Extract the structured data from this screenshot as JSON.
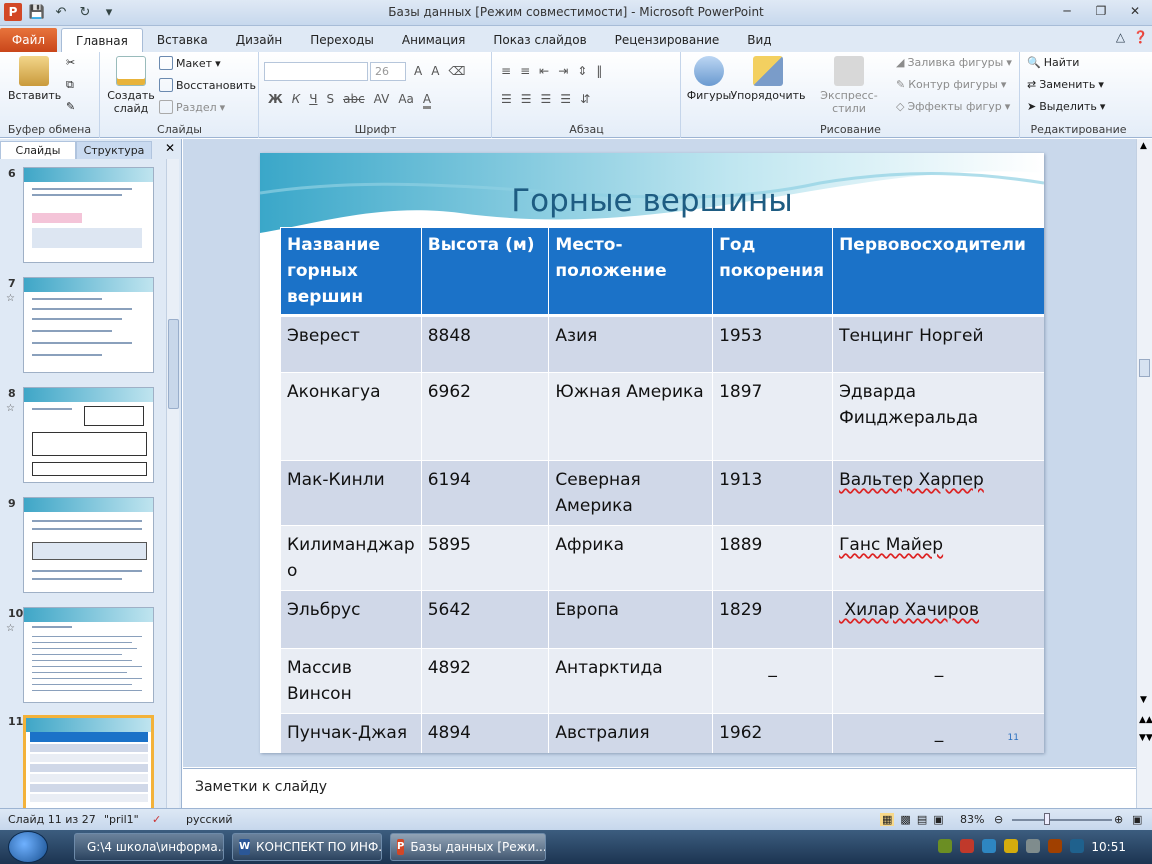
{
  "window": {
    "title": "Базы данных [Режим совместимости]  -  Microsoft PowerPoint"
  },
  "ribbon_tabs": {
    "file": "Файл",
    "tabs": [
      "Главная",
      "Вставка",
      "Дизайн",
      "Переходы",
      "Анимация",
      "Показ слайдов",
      "Рецензирование",
      "Вид"
    ]
  },
  "ribbon": {
    "clipboard": {
      "paste": "Вставить",
      "label": "Буфер обмена"
    },
    "slides": {
      "create": "Создать",
      "create2": "слайд",
      "layout": "Макет",
      "reset": "Восстановить",
      "section": "Раздел",
      "label": "Слайды"
    },
    "font": {
      "size": "26",
      "label": "Шрифт",
      "bold": "Ж",
      "italic": "К",
      "underline": "Ч",
      "strike": "S",
      "shadow": "abc",
      "spacing": "AV",
      "case": "Aa",
      "grow": "A",
      "shrink": "A",
      "color": "A"
    },
    "paragraph": {
      "label": "Абзац"
    },
    "drawing": {
      "shapes": "Фигуры",
      "arrange": "Упорядочить",
      "quick_styles": "Экспресс-стили",
      "fill": "Заливка фигуры",
      "outline": "Контур фигуры",
      "effects": "Эффекты фигур",
      "label": "Рисование"
    },
    "editing": {
      "find": "Найти",
      "replace": "Заменить",
      "select": "Выделить",
      "label": "Редактирование"
    }
  },
  "left_panel": {
    "tab_slides": "Слайды",
    "tab_outline": "Структура",
    "close": "✕",
    "thumbs": [
      {
        "num": "6",
        "star": ""
      },
      {
        "num": "7",
        "star": "☆"
      },
      {
        "num": "8",
        "star": "☆"
      },
      {
        "num": "9",
        "star": ""
      },
      {
        "num": "10",
        "star": "☆"
      },
      {
        "num": "11",
        "star": "☆"
      }
    ]
  },
  "slide": {
    "title": "Горные вершины",
    "number": "11",
    "headers": [
      "Название горных вершин",
      "Высота  (м)",
      "Место-\nположение",
      "Год покорения",
      "Первовосходители"
    ],
    "rows": [
      [
        "Эверест",
        "8848",
        "Азия",
        "1953",
        "Тенцинг Норгей"
      ],
      [
        "Аконкагуа",
        "6962",
        "Южная Америка",
        "1897",
        "Эдварда Фицджеральда"
      ],
      [
        "Мак-Кинли",
        "6194",
        "Северная Америка",
        "1913",
        "Вальтер Харпер"
      ],
      [
        "Килиманджаро",
        "5895",
        "Африка",
        "1889",
        "Ганс Майер"
      ],
      [
        "Эльбрус",
        "5642",
        "Европа",
        "1829",
        " Хилар Хачиров"
      ],
      [
        "Массив Винсон",
        "4892",
        "Антарктида",
        "_",
        "_"
      ],
      [
        "Пунчак-Джая",
        "4894",
        "Австралия",
        "1962",
        "_"
      ]
    ]
  },
  "notes": {
    "placeholder": "Заметки к слайду"
  },
  "status": {
    "slide_of": "Слайд 11 из 27",
    "theme": "\"pril1\"",
    "language": "русский",
    "zoom": "83%"
  },
  "taskbar": {
    "items": [
      "G:\\4 школа\\информа...",
      "КОНСПЕКТ ПО ИНФ...",
      "Базы данных [Режи..."
    ],
    "time": "10:51"
  }
}
